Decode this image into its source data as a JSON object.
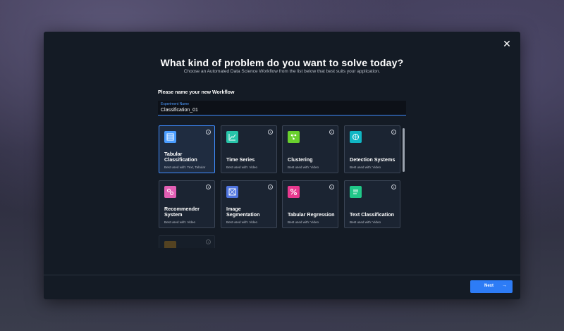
{
  "dialog": {
    "title": "What kind of problem do you want to solve today?",
    "subtitle": "Choose an Automated Data Science Workflow from the list below that best suits your application.",
    "close_icon": "✕"
  },
  "workflow_name": {
    "section_label": "Please name your new Workflow",
    "field_label": "Experiment Name",
    "value": "Classification_01"
  },
  "cards": [
    {
      "name": "Tabular Classification",
      "use": "Best used with: Text, Tabular",
      "icon": "tabular-classification-icon",
      "color": "#4a9dff"
    },
    {
      "name": "Time Series",
      "use": "Best used with: Video",
      "icon": "time-series-icon",
      "color": "#27c4a9"
    },
    {
      "name": "Clustering",
      "use": "Best used with: Video",
      "icon": "clustering-icon",
      "color": "#69d02e"
    },
    {
      "name": "Detection Systems",
      "use": "Best used with: Video",
      "icon": "detection-icon",
      "color": "#10b5c3"
    },
    {
      "name": "Recommender System",
      "use": "Best used with: Video",
      "icon": "recommender-icon",
      "color": "#e15fb4"
    },
    {
      "name": "Image Segmentation",
      "use": "Best used with: Video",
      "icon": "image-segmentation-icon",
      "color": "#4f74df"
    },
    {
      "name": "Tabular Regression",
      "use": "Best used with: Video",
      "icon": "tabular-regression-icon",
      "color": "#e8398f"
    },
    {
      "name": "Text Classification",
      "use": "Best used with: Video",
      "icon": "text-classification-icon",
      "color": "#20c888"
    }
  ],
  "info_glyph": "i",
  "footer": {
    "next_label": "Next",
    "next_arrow": "→"
  }
}
